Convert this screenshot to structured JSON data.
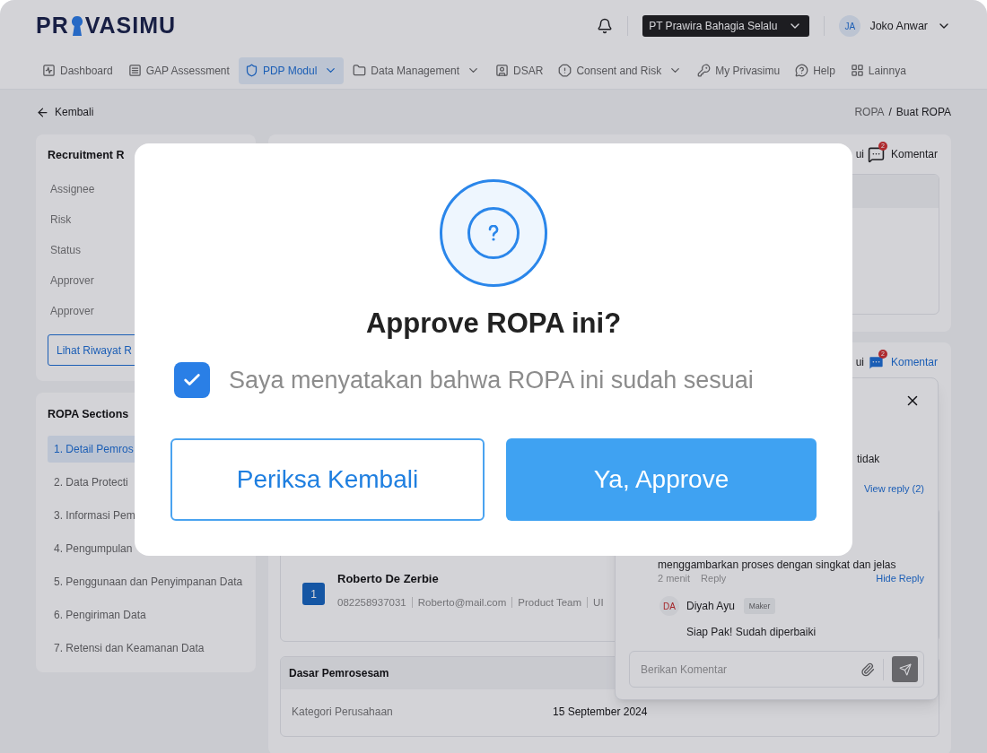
{
  "header": {
    "logo": {
      "left": "PR",
      "right": "VASIMU"
    },
    "company": "PT Prawira Bahagia Selalu",
    "user": {
      "initials": "JA",
      "name": "Joko Anwar"
    }
  },
  "nav": [
    {
      "label": "Dashboard",
      "has_menu": false,
      "selected": false
    },
    {
      "label": "GAP Assessment",
      "has_menu": false,
      "selected": false
    },
    {
      "label": "PDP Modul",
      "has_menu": true,
      "selected": true
    },
    {
      "label": "Data Management",
      "has_menu": true,
      "selected": false
    },
    {
      "label": "DSAR",
      "has_menu": false,
      "selected": false
    },
    {
      "label": "Consent and Risk",
      "has_menu": true,
      "selected": false
    },
    {
      "label": "My Privasimu",
      "has_menu": false,
      "selected": false
    },
    {
      "label": "Help",
      "has_menu": false,
      "selected": false
    },
    {
      "label": "Lainnya",
      "has_menu": false,
      "selected": false
    }
  ],
  "breadcrumb": {
    "back": "Kembali",
    "items": [
      "ROPA",
      "Buat ROPA"
    ],
    "separator": "/"
  },
  "summary_card": {
    "title": "Recruitment R",
    "fields": [
      "Assignee",
      "Risk",
      "Status",
      "Approver",
      "Approver"
    ],
    "history_button": "Lihat Riwayat R"
  },
  "sections": {
    "title": "ROPA Sections",
    "items": [
      {
        "label": "1. Detail Pemros",
        "selected": true
      },
      {
        "label": "2. Data Protecti",
        "selected": false
      },
      {
        "label": "3. Informasi Pem",
        "selected": false
      },
      {
        "label": "4. Pengumpulan",
        "selected": false
      },
      {
        "label": "5. Penggunaan dan Penyimpanan Data",
        "selected": false
      },
      {
        "label": "6. Pengiriman Data",
        "selected": false
      },
      {
        "label": "7. Retensi dan Keamanan Data",
        "selected": false
      }
    ]
  },
  "panels": [
    {
      "action_fragment": "ui",
      "comment_label": "Komentar",
      "comment_count": "2",
      "selected": false
    },
    {
      "action_fragment": "ui",
      "comment_label": "Komentar",
      "comment_count": "2",
      "selected": true
    }
  ],
  "subject": {
    "number": "1",
    "name": "Roberto De Zerbie",
    "details": [
      "082258937031",
      "Roberto@mail.com",
      "Product Team",
      "UI"
    ]
  },
  "basis": {
    "title": "Dasar Pemrosesam",
    "rows": [
      {
        "label": "Kategori Perusahaan",
        "value": "15 September 2024"
      }
    ]
  },
  "comments": {
    "fragment": "tidak",
    "view_reply": "View reply (2)",
    "text": "menggambarkan proses dengan singkat dan jelas",
    "time": "2 menit",
    "reply": "Reply",
    "hide_reply": "Hide Reply",
    "replies": [
      {
        "initials": "DA",
        "name": "Diyah Ayu",
        "role": "Maker",
        "text": "Siap Pak! Sudah diperbaiki"
      }
    ],
    "input": {
      "placeholder": "Berikan Komentar"
    }
  },
  "dialog": {
    "title": "Approve ROPA ini?",
    "confirm_checkbox": {
      "label": "Saya menyatakan bahwa ROPA ini sudah sesuai",
      "checked": true
    },
    "buttons": [
      {
        "label": "Periksa Kembali",
        "kind": "secondary"
      },
      {
        "label": "Ya, Approve",
        "kind": "primary"
      }
    ]
  }
}
